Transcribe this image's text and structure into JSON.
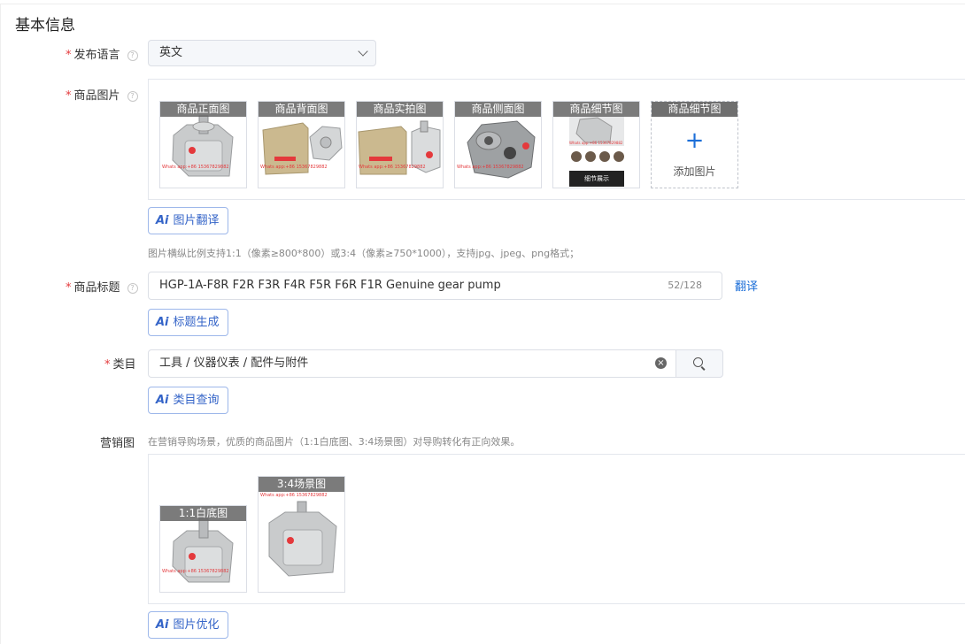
{
  "section_title": "基本信息",
  "language": {
    "label": "发布语言",
    "value": "英文"
  },
  "images": {
    "label": "商品图片",
    "slots": [
      {
        "caption": "商品正面图",
        "watermark": "Whats app:+86 15367829882"
      },
      {
        "caption": "商品背面图",
        "watermark": "Whats app:+86 15367829882"
      },
      {
        "caption": "商品实拍图",
        "watermark": "Whats app:+86 15367829882"
      },
      {
        "caption": "商品侧面图",
        "watermark": "Whats app:+86 15367829882"
      },
      {
        "caption": "商品细节图",
        "watermark": "Whats app:+86 15367829882",
        "footer": "细节展示"
      }
    ],
    "add_caption": "商品细节图",
    "add_label": "添加图片",
    "ai_button": "图片翻译",
    "hint": "图片横纵比例支持1:1（像素≥800*800）或3:4（像素≥750*1000），支持jpg、jpeg、png格式；"
  },
  "title": {
    "label": "商品标题",
    "value": "HGP-1A-F8R F2R F3R F4R F5R F6R F1R Genuine gear pump",
    "count": "52/128",
    "translate": "翻译",
    "ai_button": "标题生成"
  },
  "category": {
    "label": "类目",
    "value": "工具 / 仪器仪表 / 配件与附件",
    "ai_button": "类目查询"
  },
  "marketing": {
    "label": "营销图",
    "hint": "在营销导购场景，优质的商品图片（1:1白底图、3:4场景图）对导购转化有正向效果。",
    "img1_caption": "1:1白底图",
    "img2_caption": "3:4场景图",
    "watermark": "Whats app:+86 15367829882",
    "ai_button": "图片优化"
  },
  "ai_text": "Ai",
  "colors": {
    "accent": "#1d6fd8",
    "required": "#e4393c",
    "ai_border": "#9db7ea"
  }
}
